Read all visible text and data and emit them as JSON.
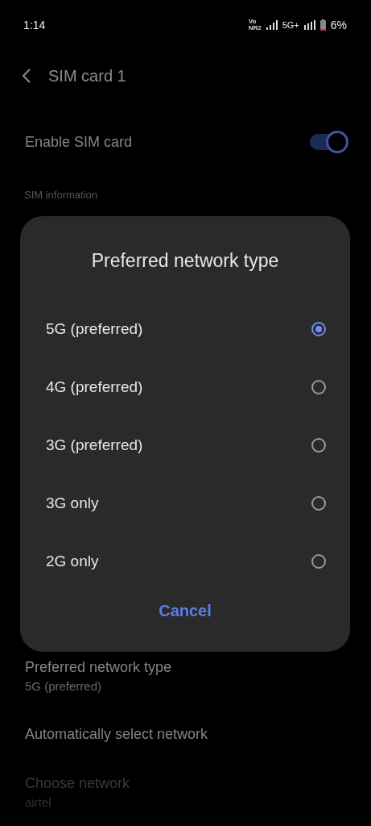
{
  "status_bar": {
    "time": "1:14",
    "volte_top": "Vo",
    "volte_bottom": "NR2",
    "network": "5G+",
    "battery": "6%"
  },
  "header": {
    "title": "SIM card 1"
  },
  "enable_sim": {
    "label": "Enable SIM card",
    "on": true
  },
  "section": "SIM information",
  "settings": [
    {
      "title": "Preferred network type",
      "subtitle": "5G (preferred)",
      "disabled": false
    },
    {
      "title": "Automatically select network",
      "disabled": false
    },
    {
      "title": "Choose network",
      "subtitle": "airtel",
      "disabled": true
    }
  ],
  "dialog": {
    "title": "Preferred network type",
    "options": [
      {
        "label": "5G (preferred)",
        "selected": true
      },
      {
        "label": "4G (preferred)",
        "selected": false
      },
      {
        "label": "3G (preferred)",
        "selected": false
      },
      {
        "label": "3G only",
        "selected": false
      },
      {
        "label": "2G only",
        "selected": false
      }
    ],
    "cancel": "Cancel"
  }
}
